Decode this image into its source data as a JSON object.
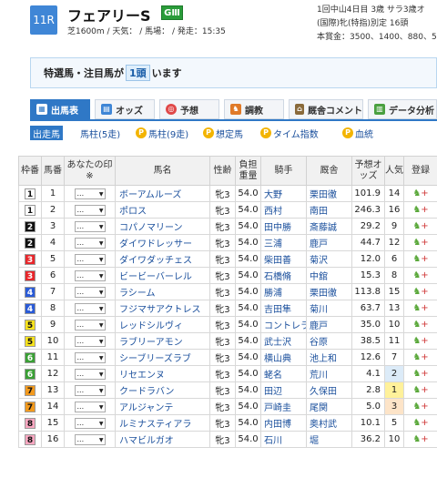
{
  "race": {
    "number": "11R",
    "name": "フェアリーS",
    "grade": "GⅢ",
    "conditions": "芝1600m / 天気： / 馬場： / 発走：15:35",
    "info_line1": "1回中山4日目 3歳 サラ3歳オ",
    "info_line2": "(国際)牝(特指)別定 16頭",
    "info_line3": "本賞金：3500、1400、880、530、"
  },
  "notice": {
    "prefix": "特選馬・注目馬が",
    "count": "1頭",
    "suffix": "います"
  },
  "tabs": [
    {
      "label": "出馬表",
      "icon": "table-icon",
      "color": "#3f86d6"
    },
    {
      "label": "オッズ",
      "icon": "odds-icon",
      "color": "#3f86d6"
    },
    {
      "label": "予想",
      "icon": "target-icon",
      "color": "#e04848"
    },
    {
      "label": "調教",
      "icon": "horse-icon",
      "color": "#e07a28"
    },
    {
      "label": "厩舎コメント",
      "icon": "stable-icon",
      "color": "#8a6a3a"
    },
    {
      "label": "データ分析",
      "icon": "chart-icon",
      "color": "#4aa040"
    }
  ],
  "subtabs": [
    {
      "label": "出走馬",
      "premium": false
    },
    {
      "label": "馬柱(5走)",
      "premium": false
    },
    {
      "label": "馬柱(9走)",
      "premium": true
    },
    {
      "label": "想定馬",
      "premium": true
    },
    {
      "label": "タイム指数",
      "premium": true
    },
    {
      "label": "血統",
      "premium": true
    }
  ],
  "columns": {
    "frame": "枠番",
    "number": "馬番",
    "my_mark": "あなたの印※",
    "horse": "馬名",
    "sex_age": "性齢",
    "weight": "負担重量",
    "jockey": "騎手",
    "trainer": "厩舎",
    "odds": "予想オッズ",
    "popularity": "人気",
    "register": "登録"
  },
  "select_placeholder": "...",
  "entries": [
    {
      "frame": "1",
      "number": "1",
      "horse": "ボーアムルーズ",
      "sex_age": "牝3",
      "weight": "54.0",
      "jockey": "大野",
      "trainer": "栗田徹",
      "odds": "101.9",
      "popularity": "14"
    },
    {
      "frame": "1",
      "number": "2",
      "horse": "ポロス",
      "sex_age": "牝3",
      "weight": "54.0",
      "jockey": "西村",
      "trainer": "南田",
      "odds": "246.3",
      "popularity": "16"
    },
    {
      "frame": "2",
      "number": "3",
      "horse": "コパノマリーン",
      "sex_age": "牝3",
      "weight": "54.0",
      "jockey": "田中勝",
      "trainer": "斎藤誠",
      "odds": "29.2",
      "popularity": "9"
    },
    {
      "frame": "2",
      "number": "4",
      "horse": "ダイワドレッサー",
      "sex_age": "牝3",
      "weight": "54.0",
      "jockey": "三浦",
      "trainer": "鹿戸",
      "odds": "44.7",
      "popularity": "12"
    },
    {
      "frame": "3",
      "number": "5",
      "horse": "ダイワダッチェス",
      "sex_age": "牝3",
      "weight": "54.0",
      "jockey": "柴田善",
      "trainer": "菊沢",
      "odds": "12.0",
      "popularity": "6"
    },
    {
      "frame": "3",
      "number": "6",
      "horse": "ビービーバーレル",
      "sex_age": "牝3",
      "weight": "54.0",
      "jockey": "石橋脩",
      "trainer": "中舘",
      "odds": "15.3",
      "popularity": "8"
    },
    {
      "frame": "4",
      "number": "7",
      "horse": "ラシーム",
      "sex_age": "牝3",
      "weight": "54.0",
      "jockey": "勝浦",
      "trainer": "栗田徹",
      "odds": "113.8",
      "popularity": "15"
    },
    {
      "frame": "4",
      "number": "8",
      "horse": "フジマサアクトレス",
      "sex_age": "牝3",
      "weight": "54.0",
      "jockey": "吉田隼",
      "trainer": "菊川",
      "odds": "63.7",
      "popularity": "13"
    },
    {
      "frame": "5",
      "number": "9",
      "horse": "レッドシルヴィ",
      "sex_age": "牝3",
      "weight": "54.0",
      "jockey": "コントレラ",
      "trainer": "鹿戸",
      "odds": "35.0",
      "popularity": "10"
    },
    {
      "frame": "5",
      "number": "10",
      "horse": "ラブリーアモン",
      "sex_age": "牝3",
      "weight": "54.0",
      "jockey": "武士沢",
      "trainer": "谷原",
      "odds": "38.5",
      "popularity": "11"
    },
    {
      "frame": "6",
      "number": "11",
      "horse": "シーブリーズラブ",
      "sex_age": "牝3",
      "weight": "54.0",
      "jockey": "横山典",
      "trainer": "池上和",
      "odds": "12.6",
      "popularity": "7"
    },
    {
      "frame": "6",
      "number": "12",
      "horse": "リセエンヌ",
      "sex_age": "牝3",
      "weight": "54.0",
      "jockey": "蛯名",
      "trainer": "荒川",
      "odds": "4.1",
      "popularity": "2"
    },
    {
      "frame": "7",
      "number": "13",
      "horse": "クードラバン",
      "sex_age": "牝3",
      "weight": "54.0",
      "jockey": "田辺",
      "trainer": "久保田",
      "odds": "2.8",
      "popularity": "1"
    },
    {
      "frame": "7",
      "number": "14",
      "horse": "アルジャンテ",
      "sex_age": "牝3",
      "weight": "54.0",
      "jockey": "戸崎圭",
      "trainer": "尾関",
      "odds": "5.0",
      "popularity": "3"
    },
    {
      "frame": "8",
      "number": "15",
      "horse": "ルミナスティアラ",
      "sex_age": "牝3",
      "weight": "54.0",
      "jockey": "内田博",
      "trainer": "奥村武",
      "odds": "10.1",
      "popularity": "5"
    },
    {
      "frame": "8",
      "number": "16",
      "horse": "ハマビルガオ",
      "sex_age": "牝3",
      "weight": "54.0",
      "jockey": "石川",
      "trainer": "堀",
      "odds": "36.2",
      "popularity": "10"
    }
  ],
  "colors": {
    "frame_bg": {
      "1": "#ffffff",
      "2": "#111111",
      "3": "#e8262b",
      "4": "#2a5bd7",
      "5": "#f6e21d",
      "6": "#3aa035",
      "7": "#f39a1e",
      "8": "#f7a7c0"
    },
    "frame_fg": {
      "1": "#111111",
      "2": "#ffffff",
      "3": "#ffffff",
      "4": "#ffffff",
      "5": "#111111",
      "6": "#ffffff",
      "7": "#111111",
      "8": "#111111"
    },
    "popularity_bg": {
      "1": "#fff19a",
      "2": "#dcebf8",
      "3": "#fde4c8"
    }
  }
}
